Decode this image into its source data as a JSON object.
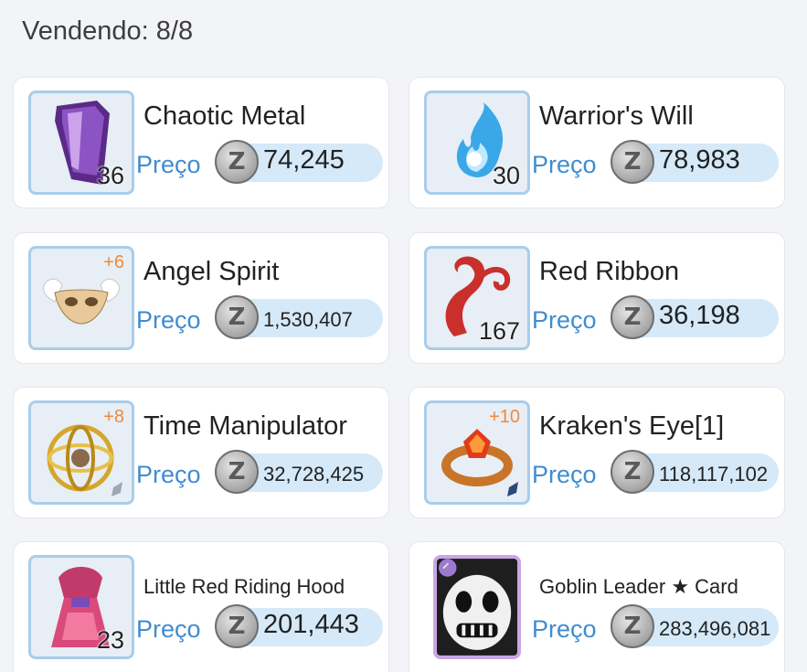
{
  "header": {
    "title": "Vendendo: 8/8"
  },
  "colors": {
    "price_label": "#3f8cd1",
    "refine": "#ef8a3c",
    "slot_border": "#a9cdea",
    "card_slot_border": "#c8a7e2"
  },
  "items": [
    {
      "name": "Chaotic Metal",
      "qty": "36",
      "refine": "",
      "price_label": "Preço",
      "currency_icon": "zeny-coin-icon",
      "currency_glyph": "Z",
      "price": "74,245",
      "icon": "purple-metal-icon"
    },
    {
      "name": "Warrior's Will",
      "qty": "30",
      "refine": "",
      "price_label": "Preço",
      "currency_icon": "zeny-coin-icon",
      "currency_glyph": "Z",
      "price": "78,983",
      "icon": "blue-flame-icon"
    },
    {
      "name": "Angel Spirit",
      "qty": "",
      "refine": "+6",
      "price_label": "Preço",
      "currency_icon": "zeny-coin-icon",
      "currency_glyph": "Z",
      "price": "1,530,407",
      "icon": "winged-mask-icon"
    },
    {
      "name": "Red Ribbon",
      "qty": "167",
      "refine": "",
      "price_label": "Preço",
      "currency_icon": "zeny-coin-icon",
      "currency_glyph": "Z",
      "price": "36,198",
      "icon": "red-ribbon-icon"
    },
    {
      "name": "Time Manipulator",
      "qty": "",
      "refine": "+8",
      "price_label": "Preço",
      "currency_icon": "zeny-coin-icon",
      "currency_glyph": "Z",
      "price": "32,728,425",
      "icon": "golden-gyroscope-icon"
    },
    {
      "name": "Kraken's Eye[1]",
      "qty": "",
      "refine": "+10",
      "price_label": "Preço",
      "currency_icon": "zeny-coin-icon",
      "currency_glyph": "Z",
      "price": "118,117,102",
      "icon": "red-gem-ring-icon"
    },
    {
      "name": "Little Red Riding Hood",
      "qty": "23",
      "refine": "",
      "price_label": "Preço",
      "currency_icon": "zeny-coin-icon",
      "currency_glyph": "Z",
      "price": "201,443",
      "icon": "red-hood-costume-icon"
    },
    {
      "name": "Goblin Leader ★ Card",
      "qty": "",
      "refine": "",
      "price_label": "Preço",
      "currency_icon": "zeny-coin-icon",
      "currency_glyph": "Z",
      "price": "283,496,081",
      "icon": "goblin-leader-card-icon"
    }
  ]
}
